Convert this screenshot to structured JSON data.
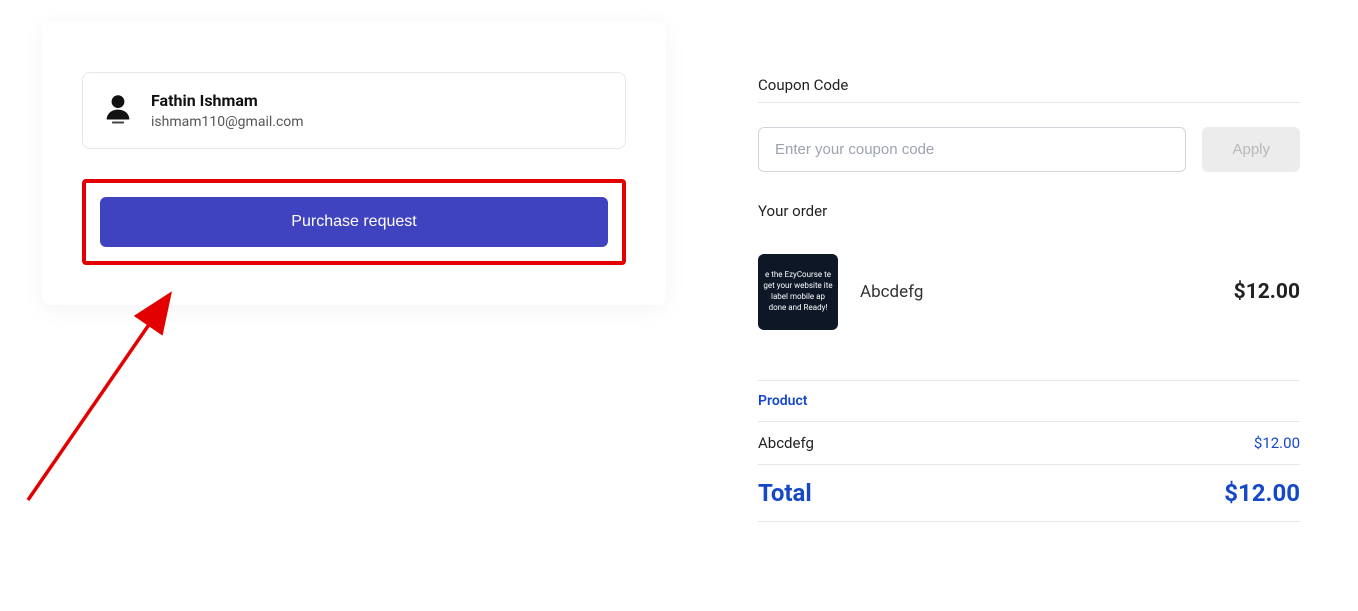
{
  "user": {
    "name": "Fathin Ishmam",
    "email": "ishmam110@gmail.com"
  },
  "purchase": {
    "button_label": "Purchase request"
  },
  "coupon": {
    "label": "Coupon Code",
    "placeholder": "Enter your coupon code",
    "apply_label": "Apply"
  },
  "order": {
    "label": "Your order",
    "thumb_text": "e the EzyCourse te\nget your website\nite label mobile ap\ndone and Ready!",
    "item_name": "Abcdefg",
    "item_price": "$12.00"
  },
  "summary": {
    "header": "Product",
    "row_name": "Abcdefg",
    "row_price": "$12.00",
    "total_label": "Total",
    "total_price": "$12.00"
  }
}
